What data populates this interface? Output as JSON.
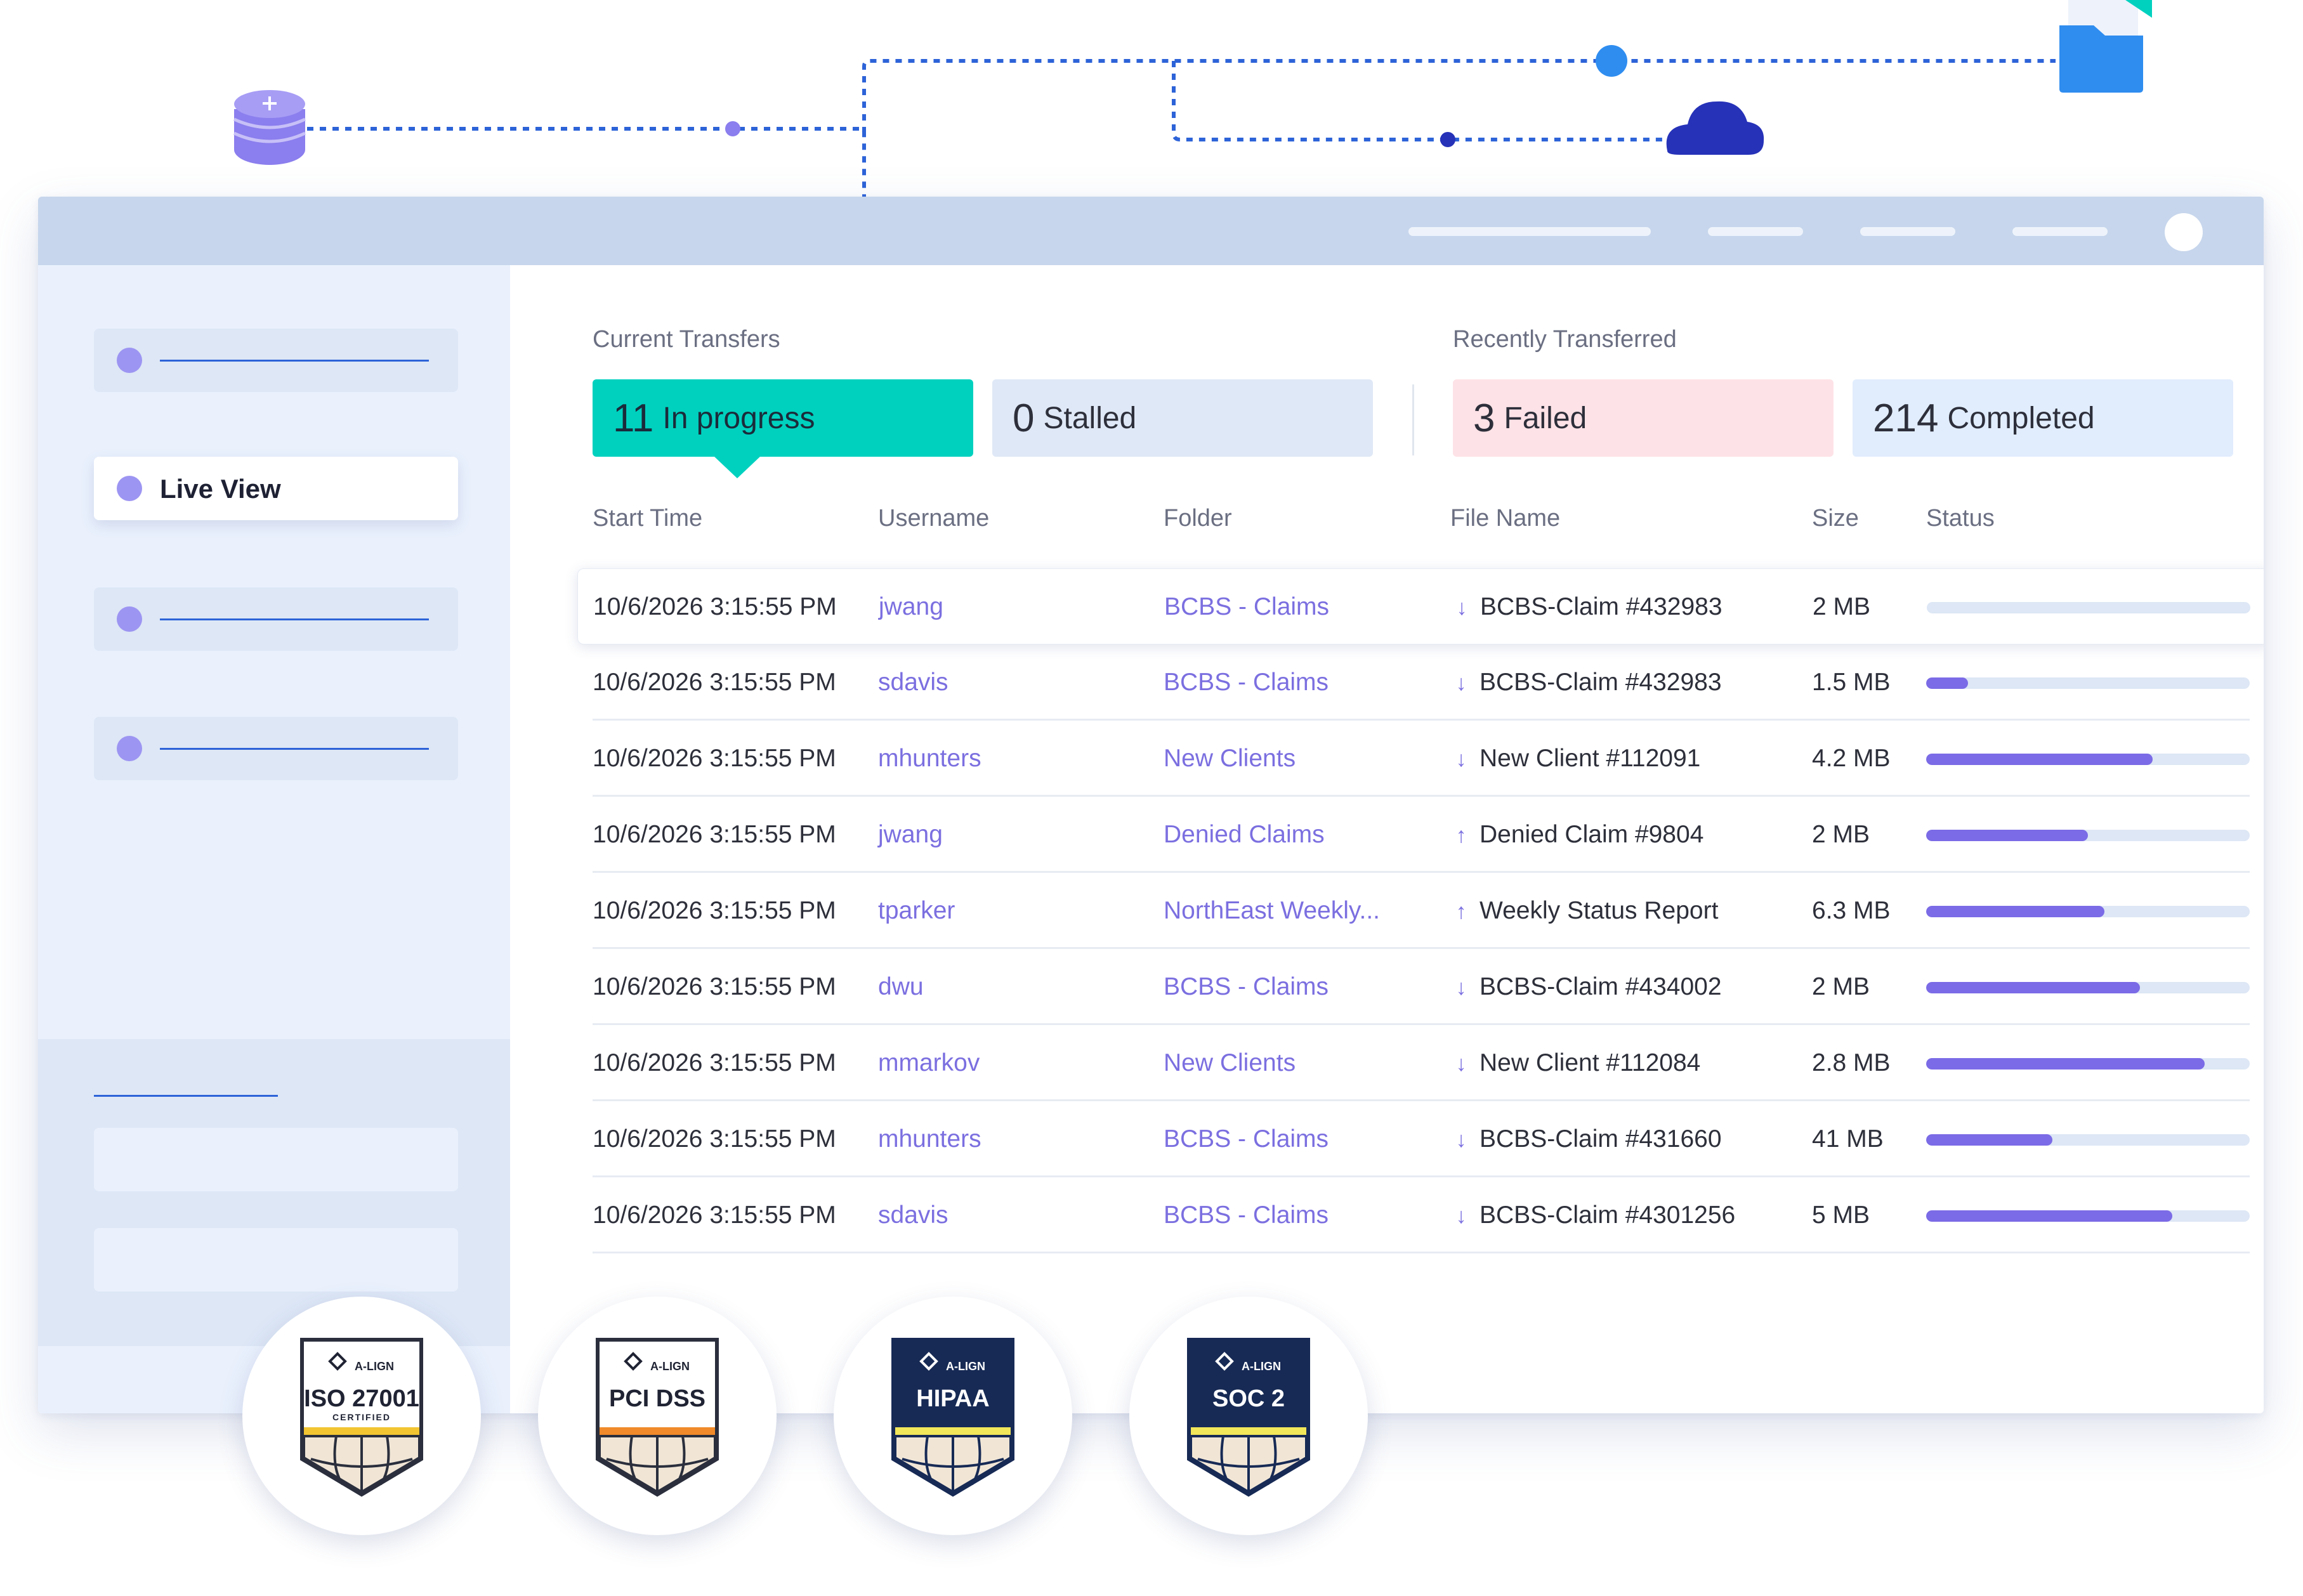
{
  "navigation": {
    "active_label": "Live View"
  },
  "current_transfers": {
    "title": "Current Transfers",
    "in_progress": {
      "count": "11",
      "label": "In progress"
    },
    "stalled": {
      "count": "0",
      "label": "Stalled"
    }
  },
  "recently_transferred": {
    "title": "Recently Transferred",
    "failed": {
      "count": "3",
      "label": "Failed"
    },
    "completed": {
      "count": "214",
      "label": "Completed"
    }
  },
  "table": {
    "columns": [
      "Start Time",
      "Username",
      "Folder",
      "File Name",
      "Size",
      "Status"
    ],
    "rows": [
      {
        "start_time": "10/6/2026 3:15:55 PM",
        "username": "jwang",
        "folder": "BCBS - Claims",
        "direction": "download",
        "file_name": "BCBS-Claim #432983",
        "size": "2 MB",
        "progress": 0.0
      },
      {
        "start_time": "10/6/2026 3:15:55 PM",
        "username": "sdavis",
        "folder": "BCBS - Claims",
        "direction": "download",
        "file_name": "BCBS-Claim #432983",
        "size": "1.5 MB",
        "progress": 0.13
      },
      {
        "start_time": "10/6/2026 3:15:55 PM",
        "username": "mhunters",
        "folder": "New Clients",
        "direction": "download",
        "file_name": "New Client #112091",
        "size": "4.2 MB",
        "progress": 0.7
      },
      {
        "start_time": "10/6/2026 3:15:55 PM",
        "username": "jwang",
        "folder": "Denied Claims",
        "direction": "upload",
        "file_name": "Denied Claim #9804",
        "size": "2 MB",
        "progress": 0.5
      },
      {
        "start_time": "10/6/2026 3:15:55 PM",
        "username": "tparker",
        "folder": "NorthEast Weekly...",
        "direction": "upload",
        "file_name": "Weekly Status Report",
        "size": "6.3 MB",
        "progress": 0.55
      },
      {
        "start_time": "10/6/2026 3:15:55 PM",
        "username": "dwu",
        "folder": "BCBS - Claims",
        "direction": "download",
        "file_name": "BCBS-Claim #434002",
        "size": "2 MB",
        "progress": 0.66
      },
      {
        "start_time": "10/6/2026 3:15:55 PM",
        "username": "mmarkov",
        "folder": "New Clients",
        "direction": "download",
        "file_name": "New Client #112084",
        "size": "2.8 MB",
        "progress": 0.86
      },
      {
        "start_time": "10/6/2026 3:15:55 PM",
        "username": "mhunters",
        "folder": "BCBS - Claims",
        "direction": "download",
        "file_name": "BCBS-Claim #431660",
        "size": "41 MB",
        "progress": 0.39
      },
      {
        "start_time": "10/6/2026 3:15:55 PM",
        "username": "sdavis",
        "folder": "BCBS - Claims",
        "direction": "download",
        "file_name": "BCBS-Claim #4301256",
        "size": "5 MB",
        "progress": 0.76
      }
    ]
  },
  "badges": [
    {
      "brand": "A-LIGN",
      "name": "ISO 27001",
      "sub": "CERTIFIED",
      "style": "light"
    },
    {
      "brand": "A-LIGN",
      "name": "PCI DSS",
      "sub": "",
      "style": "light"
    },
    {
      "brand": "A-LIGN",
      "name": "HIPAA",
      "sub": "",
      "style": "dark"
    },
    {
      "brand": "A-LIGN",
      "name": "SOC 2",
      "sub": "",
      "style": "dark"
    }
  ],
  "icons": {
    "database": "database-icon",
    "cloud": "cloud-icon",
    "folder": "folder-icon",
    "download": "arrow-down-icon",
    "upload": "arrow-up-icon"
  },
  "colors": {
    "accent_teal": "#00d1bf",
    "accent_purple": "#7b6be6",
    "link_purple": "#7b6fe0",
    "connector_blue": "#2d63d8",
    "failed_pink": "#fde2e7"
  }
}
